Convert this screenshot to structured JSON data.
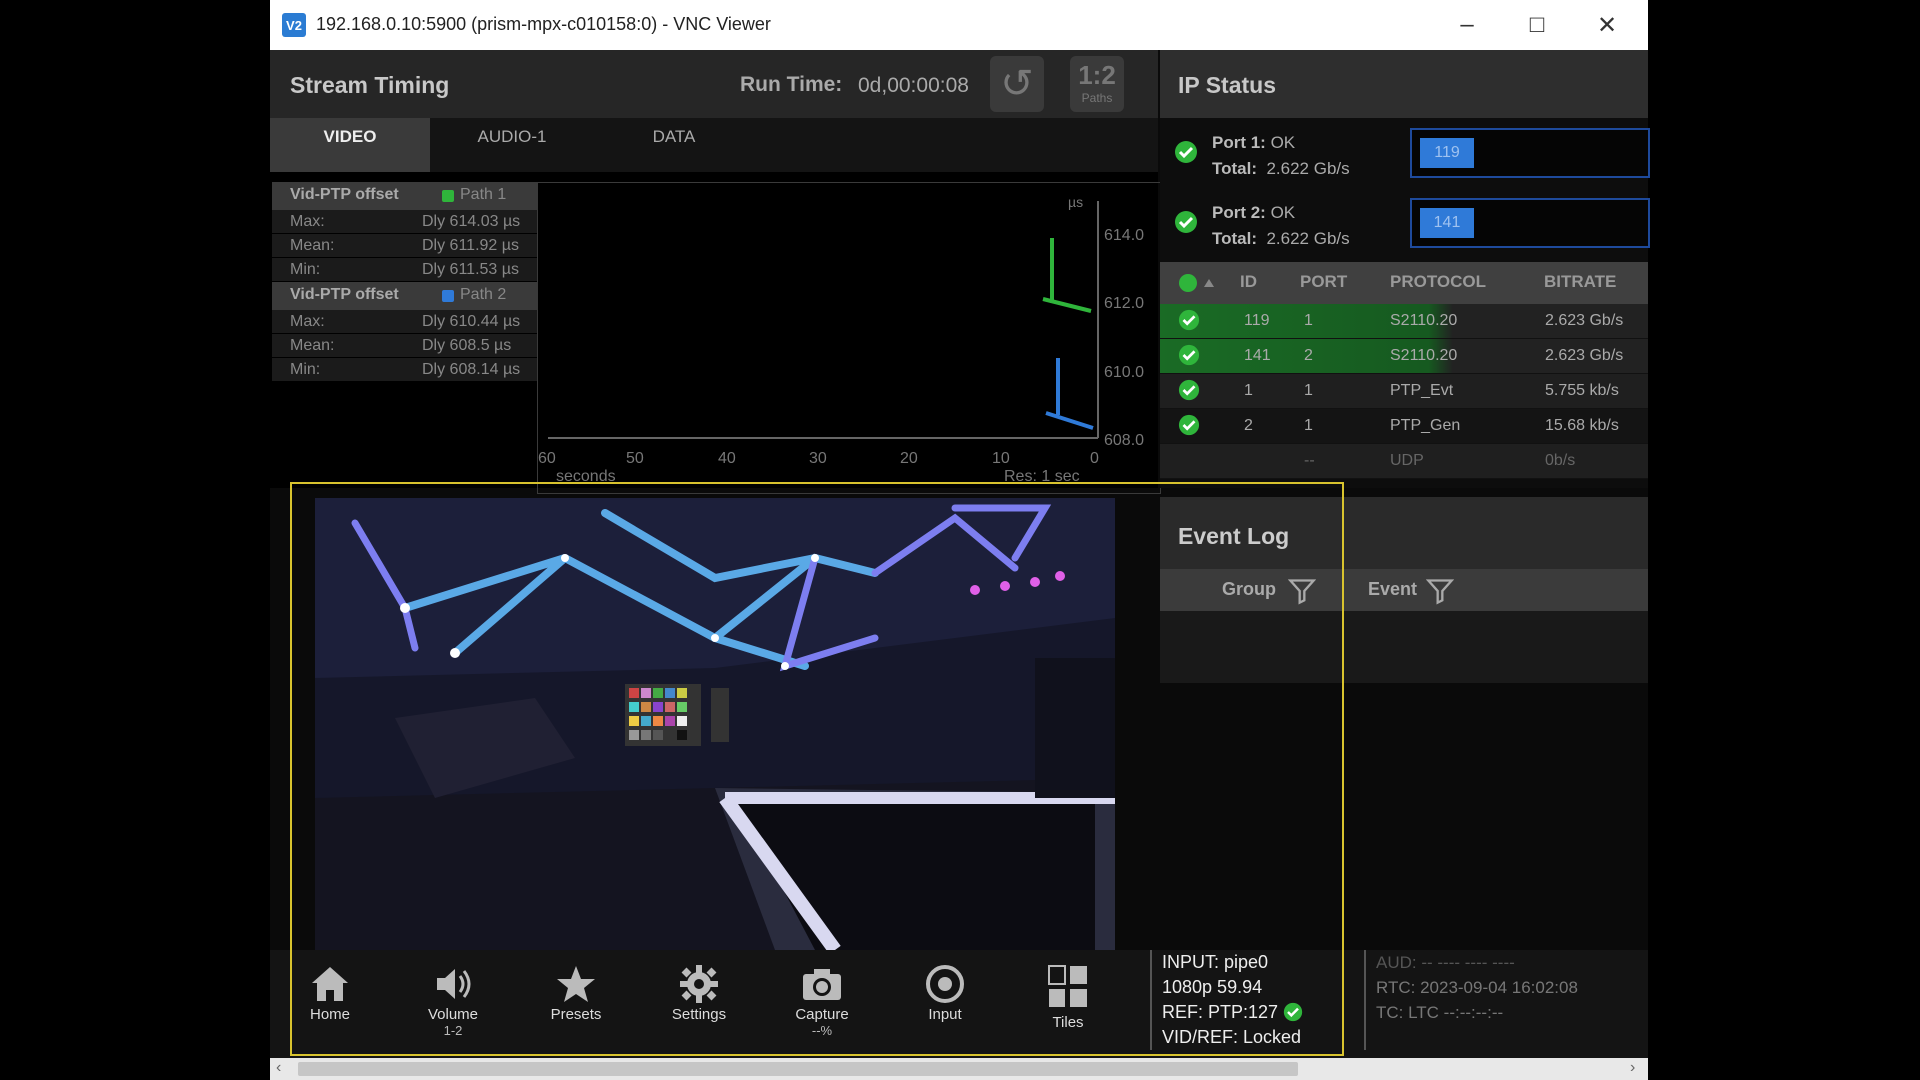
{
  "window": {
    "title": "192.168.0.10:5900 (prism-mpx-c010158:0) - VNC Viewer",
    "app_icon": "V2"
  },
  "stream_timing": {
    "title": "Stream Timing",
    "run_time_label": "Run Time:",
    "run_time_value": "0d,00:00:08",
    "paths_label": "1:2",
    "paths_sub": "Paths",
    "tabs": [
      "VIDEO",
      "AUDIO-1",
      "DATA"
    ],
    "groups": [
      {
        "name": "Vid-PTP offset",
        "path": "Path 1",
        "rows": [
          {
            "k": "Max:",
            "v": "Dly 614.03 µs"
          },
          {
            "k": "Mean:",
            "v": "Dly 611.92 µs"
          },
          {
            "k": "Min:",
            "v": "Dly 611.53 µs"
          }
        ]
      },
      {
        "name": "Vid-PTP offset",
        "path": "Path 2",
        "rows": [
          {
            "k": "Max:",
            "v": "Dly 610.44 µs"
          },
          {
            "k": "Mean:",
            "v": "Dly 608.5 µs"
          },
          {
            "k": "Min:",
            "v": "Dly 608.14 µs"
          }
        ]
      }
    ],
    "chart_labels": {
      "unit": "µs",
      "xlabel": "seconds",
      "res": "Res: 1 sec",
      "yticks": [
        "614.0",
        "612.0",
        "610.0",
        "608.0"
      ],
      "xticks": [
        "60",
        "50",
        "40",
        "30",
        "20",
        "10",
        "0"
      ]
    }
  },
  "ip_status": {
    "title": "IP Status",
    "ports": [
      {
        "name": "Port 1:",
        "status": "OK",
        "total_label": "Total:",
        "total": "2.622 Gb/s",
        "chip": "119"
      },
      {
        "name": "Port 2:",
        "status": "OK",
        "total_label": "Total:",
        "total": "2.622 Gb/s",
        "chip": "141"
      }
    ],
    "columns": [
      "ID",
      "PORT",
      "PROTOCOL",
      "BITRATE"
    ],
    "rows": [
      {
        "id": "119",
        "port": "1",
        "protocol": "S2110.20",
        "bitrate": "2.623 Gb/s"
      },
      {
        "id": "141",
        "port": "2",
        "protocol": "S2110.20",
        "bitrate": "2.623 Gb/s"
      },
      {
        "id": "1",
        "port": "1",
        "protocol": "PTP_Evt",
        "bitrate": "5.755 kb/s"
      },
      {
        "id": "2",
        "port": "1",
        "protocol": "PTP_Gen",
        "bitrate": "15.68 kb/s"
      },
      {
        "id": "",
        "port": "--",
        "protocol": "UDP",
        "bitrate": "0b/s"
      }
    ]
  },
  "event_log": {
    "title": "Event Log",
    "col_group": "Group",
    "col_event": "Event"
  },
  "toolbar": {
    "buttons": [
      {
        "label": "Home",
        "sub": "",
        "icon": "home-icon"
      },
      {
        "label": "Volume",
        "sub": "1-2",
        "icon": "volume-icon"
      },
      {
        "label": "Presets",
        "sub": "",
        "icon": "star-icon"
      },
      {
        "label": "Settings",
        "sub": "",
        "icon": "gear-icon"
      },
      {
        "label": "Capture",
        "sub": "--%",
        "icon": "camera-icon"
      },
      {
        "label": "Input",
        "sub": "",
        "icon": "input-icon"
      },
      {
        "label": "Tiles",
        "sub": "",
        "icon": "tiles-icon"
      }
    ],
    "status": {
      "input": "INPUT: pipe0",
      "format": "1080p 59.94",
      "ref": "REF: PTP:127",
      "vidref": "VID/REF: Locked"
    },
    "status2": {
      "aud": "AUD:  -- ---- ---- ----",
      "rtc": "RTC: 2023-09-04 16:02:08",
      "tc": "TC: LTC --:--:--:--"
    }
  },
  "colors": {
    "path1": "#2fb53b",
    "path2": "#2f7ad8",
    "highlight": "#d8c32e",
    "ok_green": "#2fb53b"
  }
}
